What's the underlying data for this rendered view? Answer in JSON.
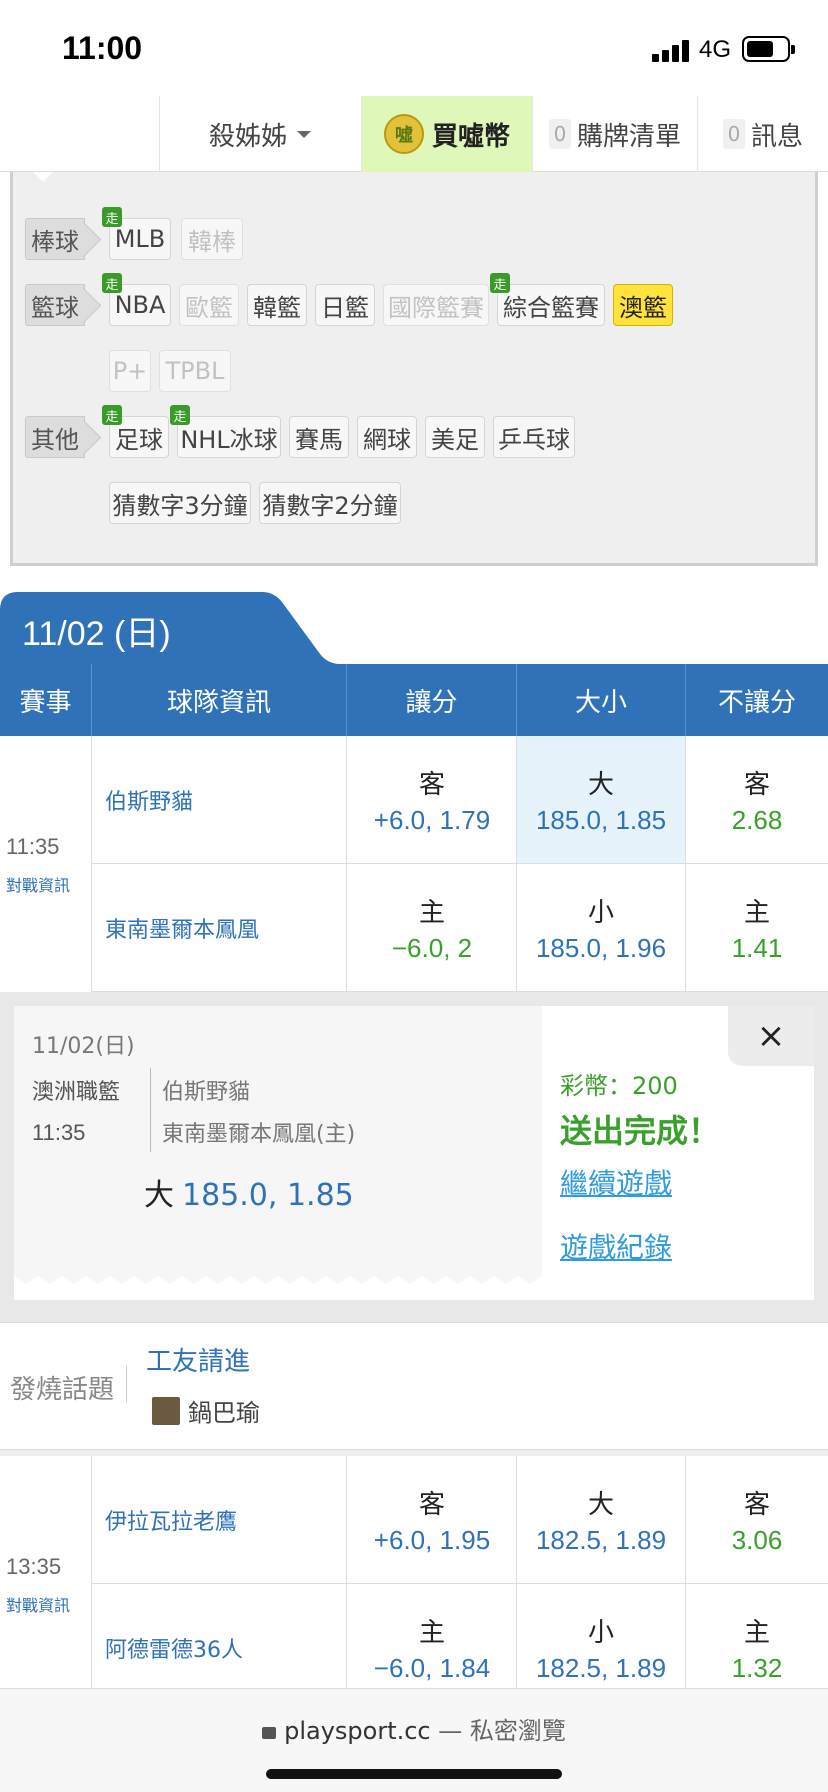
{
  "status": {
    "time": "11:00",
    "network": "4G"
  },
  "nav": {
    "user": "殺姊姊",
    "buy": "買噓幣",
    "coin_glyph": "噓",
    "cart_count": "0",
    "cart": "購牌清單",
    "msg_count": "0",
    "msg": "訊息"
  },
  "sports": {
    "walk_badge": "走",
    "baseball": {
      "label": "棒球",
      "items": [
        "MLB",
        "韓棒"
      ]
    },
    "basketball": {
      "label": "籃球",
      "items": [
        "NBA",
        "歐籃",
        "韓籃",
        "日籃",
        "國際籃賽",
        "綜合籃賽",
        "澳籃",
        "P+",
        "TPBL"
      ]
    },
    "other": {
      "label": "其他",
      "items": [
        "足球",
        "NHL冰球",
        "賽馬",
        "網球",
        "美足",
        "乒乓球",
        "猜數字3分鐘",
        "猜數字2分鐘"
      ]
    }
  },
  "date_header": "11/02 (日)",
  "table_header": [
    "賽事",
    "球隊資訊",
    "讓分",
    "大小",
    "不讓分"
  ],
  "games": [
    {
      "time": "11:35",
      "h2h": "對戰資訊",
      "away": {
        "team": "伯斯野貓",
        "spread_label": "客",
        "spread": "+6.0, 1.79",
        "total_label": "大",
        "total": "185.0, 1.85",
        "ml_label": "客",
        "ml": "2.68"
      },
      "home": {
        "team": "東南墨爾本鳳凰",
        "spread_label": "主",
        "spread": "−6.0, 2",
        "total_label": "小",
        "total": "185.0, 1.96",
        "ml_label": "主",
        "ml": "1.41"
      }
    },
    {
      "time": "13:35",
      "h2h": "對戰資訊",
      "away": {
        "team": "伊拉瓦拉老鷹",
        "spread_label": "客",
        "spread": "+6.0, 1.95",
        "total_label": "大",
        "total": "182.5, 1.89",
        "ml_label": "客",
        "ml": "3.06"
      },
      "home": {
        "team": "阿德雷德36人",
        "spread_label": "主",
        "spread": "−6.0, 1.84",
        "total_label": "小",
        "total": "182.5, 1.89",
        "ml_label": "主",
        "ml": "1.32"
      }
    }
  ],
  "popup": {
    "date": "11/02(日)",
    "league": "澳洲職籃",
    "time": "11:35",
    "team1": "伯斯野貓",
    "team2": "東南墨爾本鳳凰(主)",
    "bet_label": "大",
    "bet_value": "185.0, 1.85",
    "coins": "彩幣：200",
    "done": "送出完成！",
    "continue": "繼續遊戲",
    "history": "遊戲紀錄",
    "close": "×"
  },
  "hot": {
    "label": "發燒話題",
    "title": "工友請進",
    "author": "鍋巴瑜"
  },
  "browser": {
    "url": "playsport.cc",
    "mode": "— 私密瀏覽"
  },
  "colors": {
    "primary": "#2f72b8",
    "green": "#3aa02c",
    "active_chip": "#ffe23a",
    "buy_bg": "#dff7b8"
  }
}
